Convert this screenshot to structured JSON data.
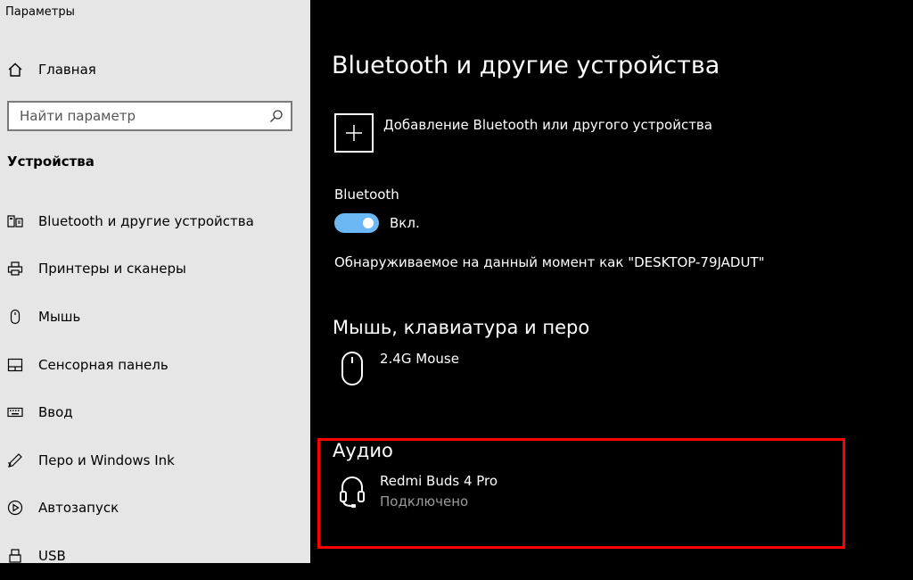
{
  "window": {
    "title": "Параметры"
  },
  "sidebar": {
    "home_label": "Главная",
    "search_placeholder": "Найти параметр",
    "section_title": "Устройства",
    "items": [
      {
        "label": "Bluetooth и другие устройства",
        "icon": "bluetooth-devices-icon"
      },
      {
        "label": "Принтеры и сканеры",
        "icon": "printer-icon"
      },
      {
        "label": "Мышь",
        "icon": "mouse-icon"
      },
      {
        "label": "Сенсорная панель",
        "icon": "touchpad-icon"
      },
      {
        "label": "Ввод",
        "icon": "keyboard-icon"
      },
      {
        "label": "Перо и Windows Ink",
        "icon": "pen-icon"
      },
      {
        "label": "Автозапуск",
        "icon": "autoplay-icon"
      },
      {
        "label": "USB",
        "icon": "usb-icon"
      }
    ]
  },
  "main": {
    "title": "Bluetooth и другие устройства",
    "add_device_label": "Добавление Bluetooth или другого устройства",
    "bluetooth_label": "Bluetooth",
    "bluetooth_state": "Вкл.",
    "discoverable_text": "Обнаруживаемое на данный момент как \"DESKTOP-79JADUT\"",
    "mouse_section": {
      "heading": "Мышь, клавиатура и перо",
      "devices": [
        {
          "name": "2.4G Mouse"
        }
      ]
    },
    "audio_section": {
      "heading": "Аудио",
      "devices": [
        {
          "name": "Redmi Buds 4 Pro",
          "status": "Подключено"
        }
      ]
    }
  },
  "colors": {
    "sidebar_bg": "#e6e6e6",
    "main_bg": "#000000",
    "toggle_on": "#6cb8f5",
    "highlight_border": "#ff0000"
  }
}
